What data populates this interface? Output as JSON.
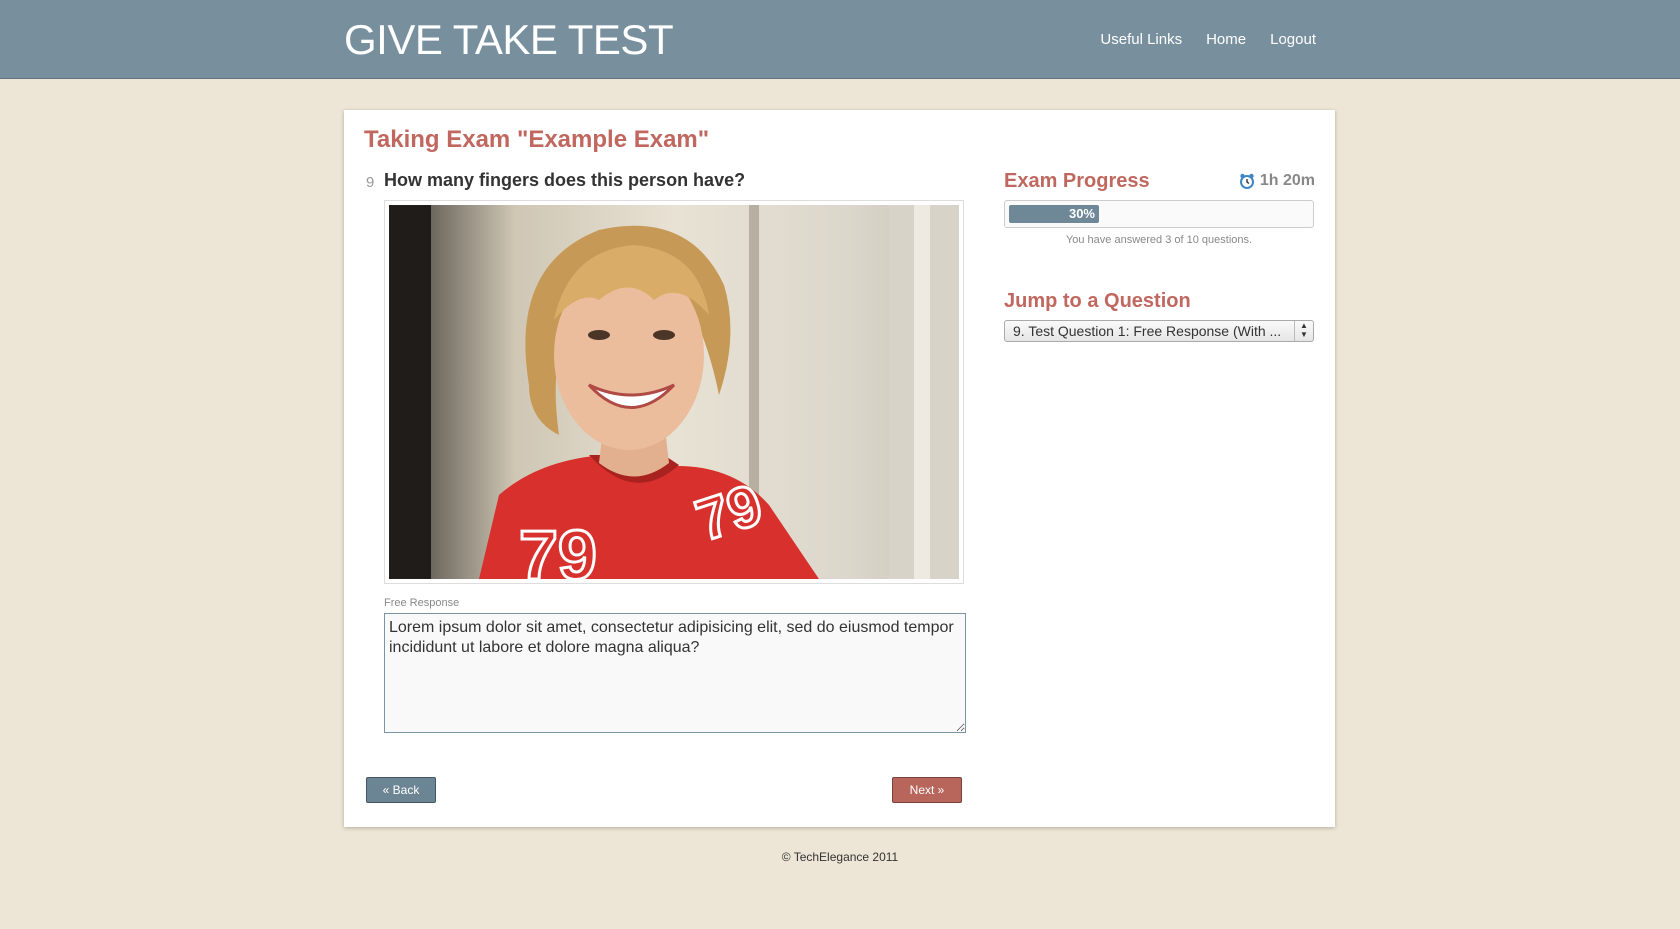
{
  "header": {
    "brand": "GIVE TAKE TEST",
    "nav": [
      "Useful Links",
      "Home",
      "Logout"
    ]
  },
  "exam": {
    "title": "Taking Exam \"Example Exam\"",
    "question_number": "9",
    "question_text": "How many fingers does this person have?",
    "free_response_label": "Free Response",
    "answer_text": "Lorem ipsum dolor sit amet, consectetur adipisicing elit, sed do eiusmod tempor incididunt ut labore et dolore magna aliqua?"
  },
  "buttons": {
    "back": "« Back",
    "next": "Next »"
  },
  "progress": {
    "heading": "Exam Progress",
    "timer": "1h 20m",
    "percent": 30,
    "percent_label": "30%",
    "note": "You have answered 3 of 10 questions."
  },
  "jump": {
    "heading": "Jump to a Question",
    "selected": "9. Test Question 1: Free Response (With ..."
  },
  "footer": {
    "text": "© TechElegance 2011"
  },
  "icons": {
    "timer": "alarm-clock-icon",
    "select": "select-arrows-icon"
  },
  "colors": {
    "header_bg": "#788f9e",
    "accent": "#c0685f",
    "page_bg": "#ede6d6"
  }
}
